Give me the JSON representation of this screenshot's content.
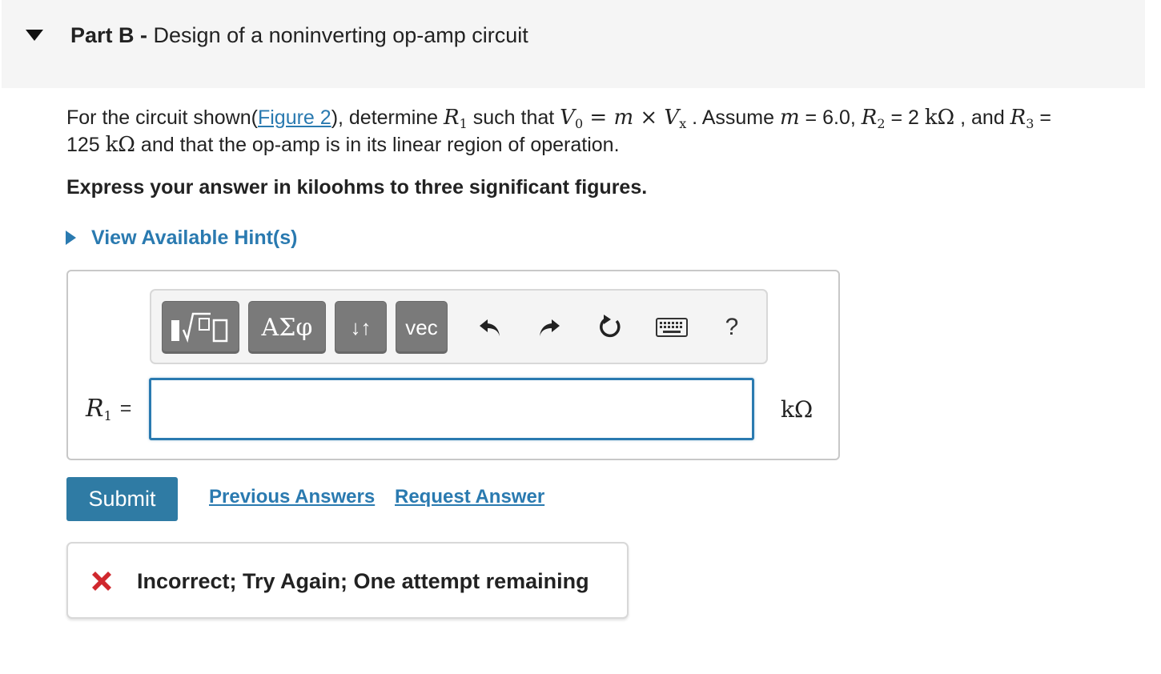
{
  "part": {
    "label": "Part B -",
    "title": "Design of a noninverting op-amp circuit"
  },
  "problem": {
    "intro": "For the circuit shown(",
    "figure_link": "Figure 2",
    "determine": "), determine ",
    "r1": "R",
    "r1_sub": "1",
    "such_that": " such that ",
    "v0": "V",
    "v0_sub": "0",
    "eq_expr_a": " = m × ",
    "vx": "V",
    "vx_sub": "x",
    "assume": " . Assume ",
    "m_var": "m",
    "m_value": " = 6.0, ",
    "r2": "R",
    "r2_sub": "2",
    "r2_value": " = 2 ",
    "kohm": "kΩ",
    "and": " , and ",
    "r3": "R",
    "r3_sub": "3",
    "eq": " = ",
    "r3_value": "125 ",
    "tail": " and that the op-amp is in its linear region of operation."
  },
  "instruction": "Express your answer in kiloohms to three significant figures.",
  "hints": {
    "label": "View Available Hint(s)"
  },
  "toolbar": {
    "greek_label": "ΑΣφ",
    "arrows_label": "↓↑",
    "vec_label": "vec",
    "help_label": "?",
    "icons": [
      "templates-icon",
      "undo-icon",
      "redo-icon",
      "reset-icon",
      "keyboard-icon"
    ]
  },
  "answer": {
    "var": "R",
    "var_sub": "1",
    "equals": "=",
    "value": "",
    "unit": "kΩ"
  },
  "actions": {
    "submit": "Submit",
    "previous_answers": "Previous Answers",
    "request_answer": "Request Answer"
  },
  "feedback": {
    "message": "Incorrect; Try Again; One attempt remaining"
  },
  "colors": {
    "accent": "#2a7ab0",
    "submit_bg": "#2f7ba4",
    "error": "#d0282e",
    "toolbar_button": "#7a7a7a"
  }
}
